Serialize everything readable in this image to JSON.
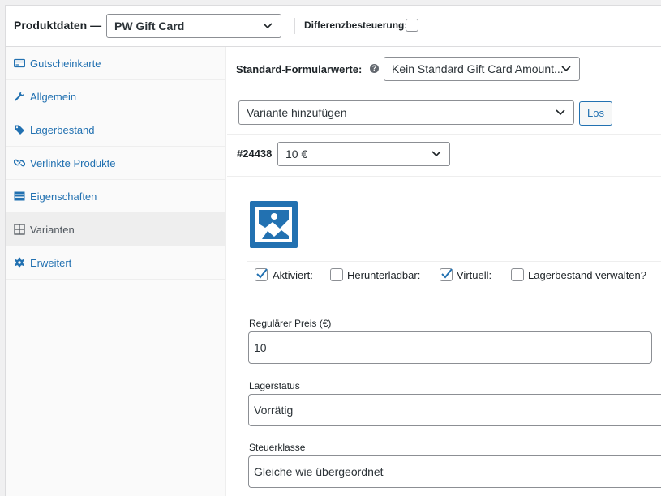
{
  "header": {
    "title": "Produktdaten —",
    "product_type": "PW Gift Card",
    "checkbox_label": "Differenzbesteuerung:",
    "checkbox_checked": false
  },
  "tabs": [
    {
      "label": "Gutscheinkarte",
      "icon": "gift-card-icon",
      "active": false
    },
    {
      "label": "Allgemein",
      "icon": "wrench-icon",
      "active": false
    },
    {
      "label": "Lagerbestand",
      "icon": "tag-icon",
      "active": false
    },
    {
      "label": "Verlinkte Produkte",
      "icon": "link-icon",
      "active": false
    },
    {
      "label": "Eigenschaften",
      "icon": "list-icon",
      "active": false
    },
    {
      "label": "Varianten",
      "icon": "grid-icon",
      "active": true
    },
    {
      "label": "Erweitert",
      "icon": "gear-icon",
      "active": false
    }
  ],
  "defaults": {
    "label": "Standard-Formularwerte:",
    "help": "?",
    "value": "Kein Standard Gift Card Amount..."
  },
  "add_variation": {
    "value": "Variante hinzufügen",
    "button": "Los"
  },
  "variation": {
    "id": "#24438",
    "amount": "10 €",
    "image_icon": "image-placeholder-icon",
    "options": [
      {
        "label": "Aktiviert:",
        "checked": true
      },
      {
        "label": "Herunterladbar:",
        "checked": false
      },
      {
        "label": "Virtuell:",
        "checked": true
      },
      {
        "label": "Lagerbestand verwalten?",
        "checked": false
      }
    ],
    "regular_price_label": "Regulärer Preis (€)",
    "regular_price": "10",
    "stock_status_label": "Lagerstatus",
    "stock_status": "Vorrätig",
    "tax_class_label": "Steuerklasse",
    "tax_class": "Gleiche wie übergeordnet"
  },
  "colors": {
    "link": "#2271b1",
    "checkbox_check": "#2271b1",
    "border": "#8c8f94"
  }
}
